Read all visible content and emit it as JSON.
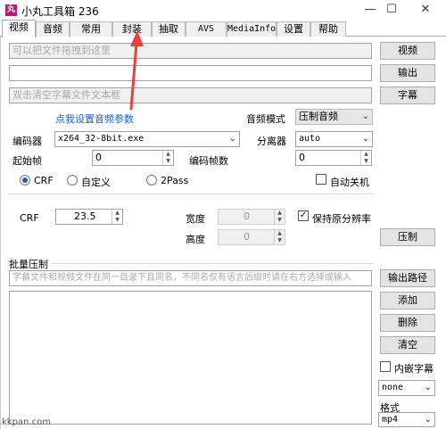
{
  "window": {
    "title": "小丸工具箱 236",
    "icon_text": "丸",
    "minimize": "—",
    "maximize": "☐",
    "close": "✕"
  },
  "tabs": [
    "视频",
    "音频",
    "常用",
    "封装",
    "抽取",
    "AVS",
    "MediaInfo",
    "设置",
    "帮助"
  ],
  "active_tab": "视频",
  "video_input": {
    "placeholder": "可以把文件拖拽到这里",
    "button": "视频"
  },
  "output_input": {
    "value": "",
    "button": "输出"
  },
  "subtitle_input": {
    "placeholder": "双击清空字幕文件文本框",
    "button": "字幕"
  },
  "audio_link": "点我设置音频参数",
  "audio_mode": {
    "label": "音频模式",
    "value": "压制音频"
  },
  "encoder": {
    "label": "编码器",
    "value": "x264_32-8bit.exe"
  },
  "demuxer": {
    "label": "分离器",
    "value": "auto"
  },
  "start_frame": {
    "label": "起始帧",
    "value": "0"
  },
  "encode_frames": {
    "label": "编码帧数",
    "value": "0"
  },
  "rate_modes": {
    "crf": "CRF",
    "custom": "自定义",
    "twopass": "2Pass"
  },
  "auto_shutdown": "自动关机",
  "crf": {
    "label": "CRF",
    "value": "23.5"
  },
  "width": {
    "label": "宽度",
    "value": "0"
  },
  "height": {
    "label": "高度",
    "value": "0"
  },
  "keep_resolution": "保持原分辨率",
  "encode_button": "压制",
  "batch": {
    "title": "批量压制",
    "hint": "字幕文件和视频文件在同一目录下且同名，不同名仅有语言后缀时请在右方选择或输入",
    "output_path_button": "输出路径",
    "add_button": "添加",
    "delete_button": "删除",
    "clear_button": "清空",
    "embed_subtitle": "内嵌字幕",
    "subtitle_lang": "none",
    "format_label": "格式",
    "format_value": "mp4"
  },
  "watermark": "kkpan.com",
  "colors": {
    "link": "#1060d8",
    "radio_selected": "#1a5fb4",
    "annotation_arrow": "#e8403a",
    "app_icon": "#c0186e"
  }
}
